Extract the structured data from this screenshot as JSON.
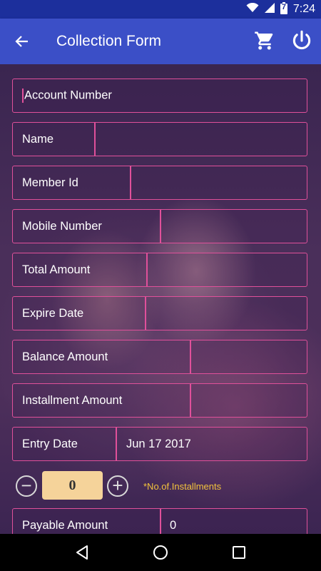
{
  "status_bar": {
    "time": "7:24",
    "battery_level": "7"
  },
  "app_bar": {
    "title": "Collection Form"
  },
  "form": {
    "account_number": {
      "placeholder": "Account Number"
    },
    "name": {
      "label": "Name",
      "value": ""
    },
    "member_id": {
      "label": "Member Id",
      "value": ""
    },
    "mobile_number": {
      "label": "Mobile Number",
      "value": ""
    },
    "total_amount": {
      "label": "Total Amount",
      "value": ""
    },
    "expire_date": {
      "label": "Expire Date",
      "value": ""
    },
    "balance_amount": {
      "label": "Balance Amount",
      "value": ""
    },
    "installment_amount": {
      "label": "Installment Amount",
      "value": ""
    },
    "entry_date": {
      "label": "Entry Date",
      "value": "Jun 17 2017"
    },
    "installments": {
      "count": "0",
      "note": "*No.of.Installments",
      "minus": "−",
      "plus": "+"
    },
    "payable_amount": {
      "label": "Payable Amount",
      "value": "0"
    }
  },
  "colors": {
    "accent": "#e0509a",
    "app_bar": "#3b4fc7",
    "status_bar": "#1c2f9c",
    "note": "#f3c23c",
    "qty_bg": "#f5d39a"
  },
  "icons": [
    "wifi-icon",
    "signal-icon",
    "battery-icon",
    "back-arrow-icon",
    "cart-icon",
    "power-icon",
    "nav-back-icon",
    "nav-home-icon",
    "nav-recents-icon"
  ]
}
